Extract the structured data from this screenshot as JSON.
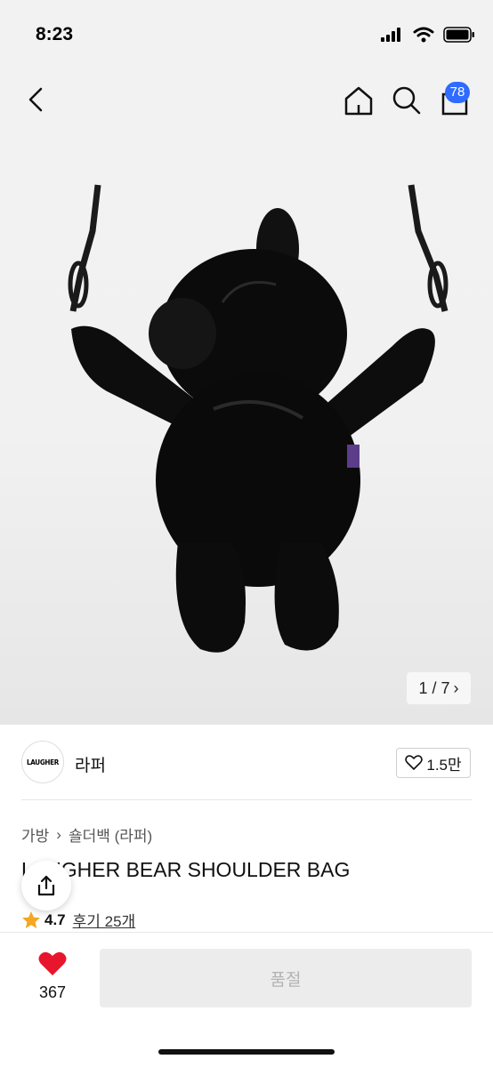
{
  "status_bar": {
    "time": "8:23"
  },
  "nav": {
    "cart_count": "78"
  },
  "gallery": {
    "counter": "1 / 7"
  },
  "brand": {
    "logo_text": "LAUGHER",
    "name": "라퍼",
    "likes": "1.5만"
  },
  "breadcrumb": {
    "category": "가방",
    "subcategory": "숄더백 (라퍼)"
  },
  "product": {
    "title": "LAUGHER BEAR SHOULDER BAG",
    "rating": "4.7",
    "reviews": "후기 25개"
  },
  "bottom_bar": {
    "wish_count": "367",
    "status_button": "품절"
  },
  "colors": {
    "accent": "#2f6bff",
    "heart": "#e8162c",
    "star": "#f5a623"
  }
}
